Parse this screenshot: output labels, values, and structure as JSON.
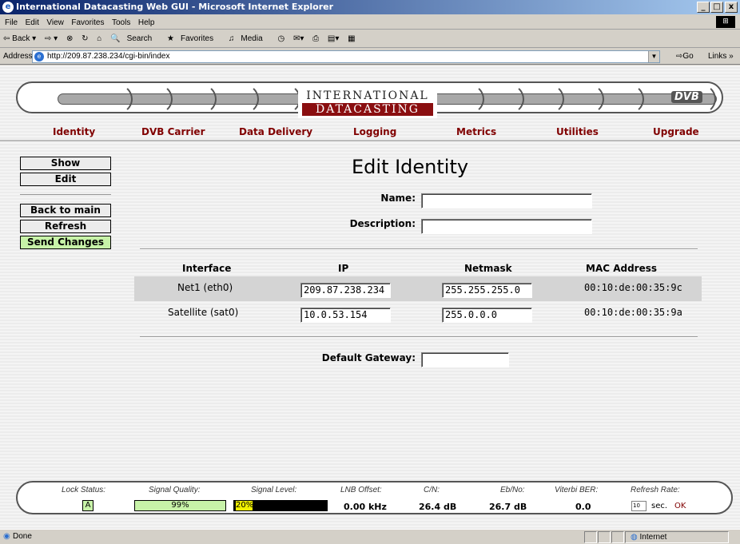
{
  "window": {
    "title": "International Datacasting Web GUI - Microsoft Internet Explorer",
    "min": "_",
    "max": "□",
    "close": "x"
  },
  "menu": [
    "File",
    "Edit",
    "View",
    "Favorites",
    "Tools",
    "Help"
  ],
  "toolbar": {
    "back": "⇦ Back ▾",
    "forward": "⇨ ▾",
    "stop": "⊗",
    "refresh": "↻",
    "home": "⌂",
    "search": "Search",
    "favorites": "Favorites",
    "media": "Media",
    "history": "◷",
    "mail": "✉▾",
    "print": "⎙",
    "edit": "▤▾",
    "discuss": "▦"
  },
  "address": {
    "label": "Address",
    "url": "http://209.87.238.234/cgi-bin/index",
    "go": "Go",
    "links": "Links »"
  },
  "logo": {
    "line1": "INTERNATIONAL",
    "line2": "DATACASTING",
    "badge": "DVB"
  },
  "nav": [
    {
      "label": "Identity"
    },
    {
      "label": "DVB Carrier"
    },
    {
      "label": "Data Delivery"
    },
    {
      "label": "Logging"
    },
    {
      "label": "Metrics"
    },
    {
      "label": "Utilities"
    },
    {
      "label": "Upgrade"
    }
  ],
  "sidebar": {
    "show": "Show",
    "edit": "Edit",
    "back": "Back to main",
    "refresh": "Refresh",
    "send": "Send Changes"
  },
  "form": {
    "title": "Edit Identity",
    "name_label": "Name:",
    "name_value": "",
    "desc_label": "Description:",
    "desc_value": "",
    "gateway_label": "Default Gateway:",
    "gateway_value": ""
  },
  "table": {
    "headers": [
      "Interface",
      "IP",
      "Netmask",
      "MAC Address"
    ],
    "rows": [
      {
        "iface": "Net1 (eth0)",
        "ip": "209.87.238.234",
        "mask": "255.255.255.0",
        "mac": "00:10:de:00:35:9c"
      },
      {
        "iface": "Satellite (sat0)",
        "ip": "10.0.53.154",
        "mask": "255.0.0.0",
        "mac": "00:10:de:00:35:9a"
      }
    ]
  },
  "status": {
    "lock_label": "Lock Status:",
    "lock_value": "A",
    "sq_label": "Signal Quality:",
    "sq_value": "99%",
    "sq_fraction": 0.99,
    "sl_label": "Signal Level:",
    "sl_value": "20%",
    "sl_fraction": 0.2,
    "lnb_label": "LNB Offset:",
    "lnb_value": "0.00 kHz",
    "cn_label": "C/N:",
    "cn_value": "26.4 dB",
    "ebno_label": "Eb/No:",
    "ebno_value": "26.7 dB",
    "ber_label": "Viterbi BER:",
    "ber_value": "0.0",
    "rr_label": "Refresh Rate:",
    "rr_value": "10",
    "rr_unit": "sec.",
    "rr_ok": "OK"
  },
  "statusbar": {
    "left": "Done",
    "zone": "Internet"
  },
  "colors": {
    "nav_link": "#800000",
    "green": "#c7f2a8",
    "logo_red": "#8a0e10",
    "level_yellow": "#f0f000"
  }
}
